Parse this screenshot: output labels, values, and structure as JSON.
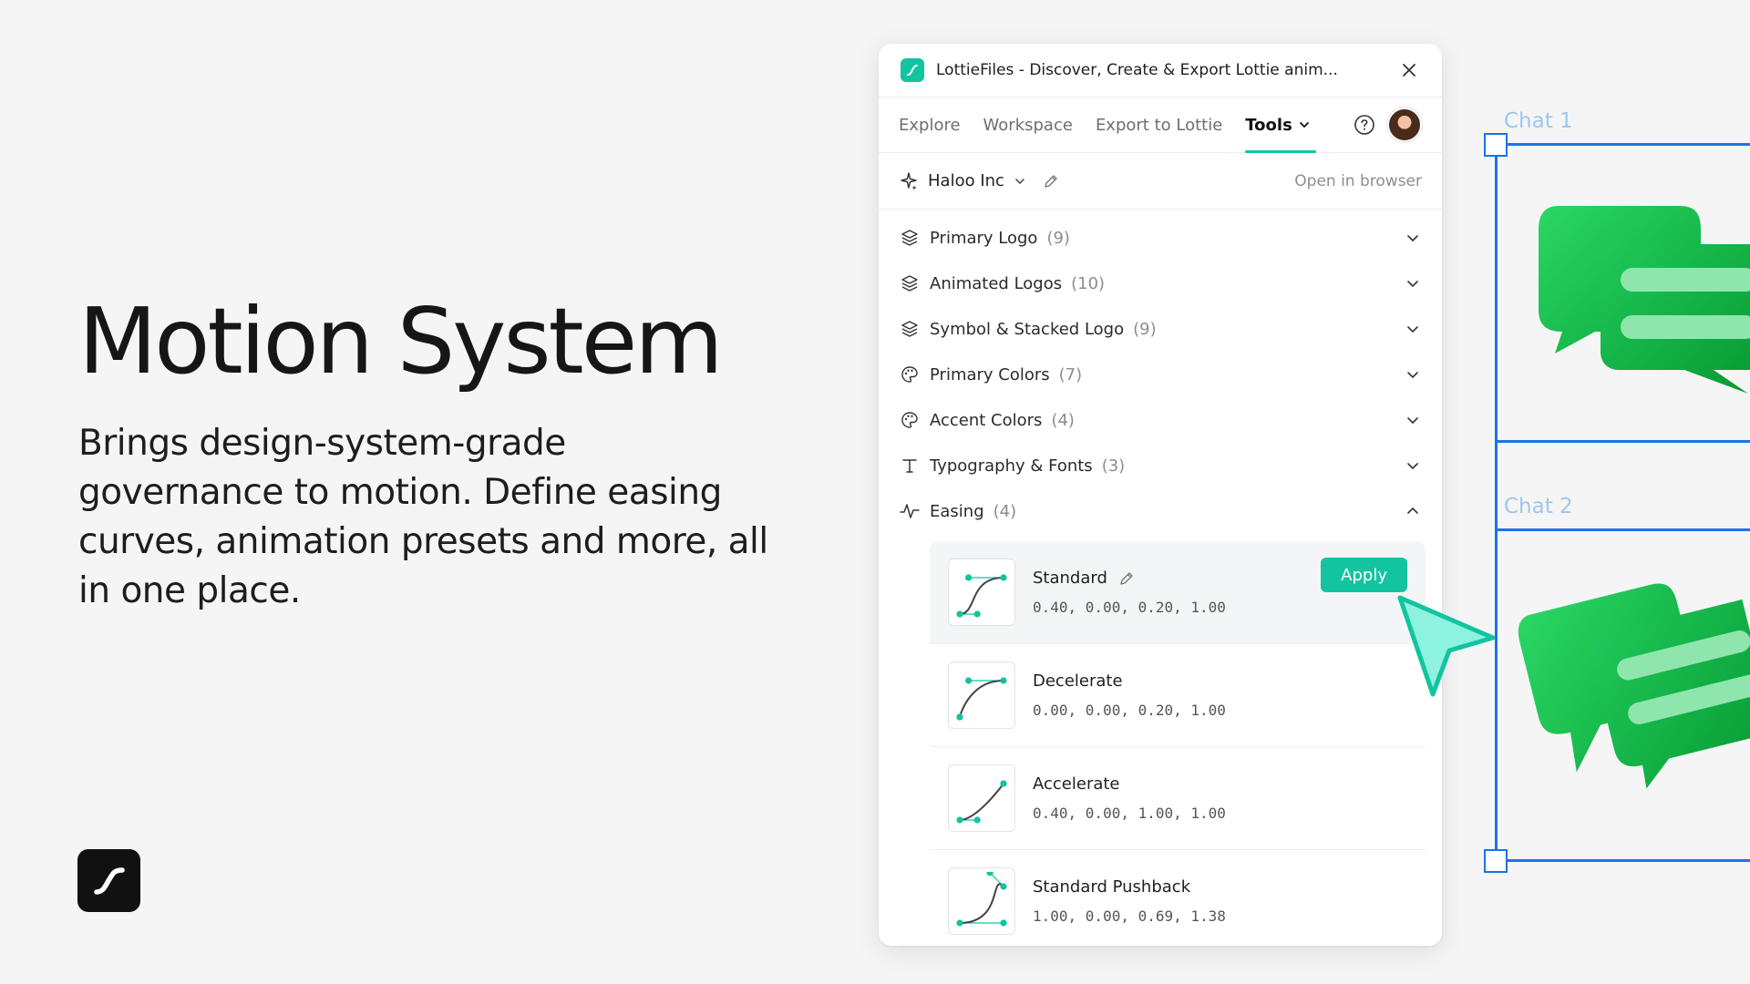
{
  "hero": {
    "title": "Motion System",
    "description": "Brings design-system-grade governance to motion. Define easing curves, animation presets and more, all in one place."
  },
  "window": {
    "title": "LottieFiles - Discover, Create & Export Lottie anim..."
  },
  "nav": {
    "tabs": [
      {
        "label": "Explore"
      },
      {
        "label": "Workspace"
      },
      {
        "label": "Export to Lottie"
      },
      {
        "label": "Tools"
      }
    ],
    "active_tab": "Tools"
  },
  "workspace": {
    "name": "Haloo Inc",
    "open_browser": "Open in browser"
  },
  "sections": [
    {
      "label": "Primary Logo",
      "count": "(9)",
      "icon": "layers-icon"
    },
    {
      "label": "Animated Logos",
      "count": "(10)",
      "icon": "layers-icon"
    },
    {
      "label": "Symbol & Stacked Logo",
      "count": "(9)",
      "icon": "layers-icon"
    },
    {
      "label": "Primary Colors",
      "count": "(7)",
      "icon": "palette-icon"
    },
    {
      "label": "Accent Colors",
      "count": "(4)",
      "icon": "palette-icon"
    },
    {
      "label": "Typography & Fonts",
      "count": "(3)",
      "icon": "type-icon"
    },
    {
      "label": "Easing",
      "count": "(4)",
      "icon": "easing-icon",
      "expanded": true
    }
  ],
  "easings": [
    {
      "name": "Standard",
      "values": "0.40, 0.00, 0.20, 1.00",
      "bezier": [
        0.4,
        0.0,
        0.2,
        1.0
      ]
    },
    {
      "name": "Decelerate",
      "values": "0.00, 0.00, 0.20, 1.00",
      "bezier": [
        0.0,
        0.0,
        0.2,
        1.0
      ]
    },
    {
      "name": "Accelerate",
      "values": "0.40, 0.00, 1.00, 1.00",
      "bezier": [
        0.4,
        0.0,
        1.0,
        1.0
      ]
    },
    {
      "name": "Standard Pushback",
      "values": "1.00, 0.00, 0.69, 1.38",
      "bezier": [
        1.0,
        0.0,
        0.69,
        1.38
      ]
    }
  ],
  "apply_label": "Apply",
  "canvas": {
    "frame1_label": "Chat 1",
    "frame2_label": "Chat 2"
  },
  "colors": {
    "accent": "#12c4a0",
    "selection": "#1a73e8",
    "chat_green": "#1fc44a"
  }
}
